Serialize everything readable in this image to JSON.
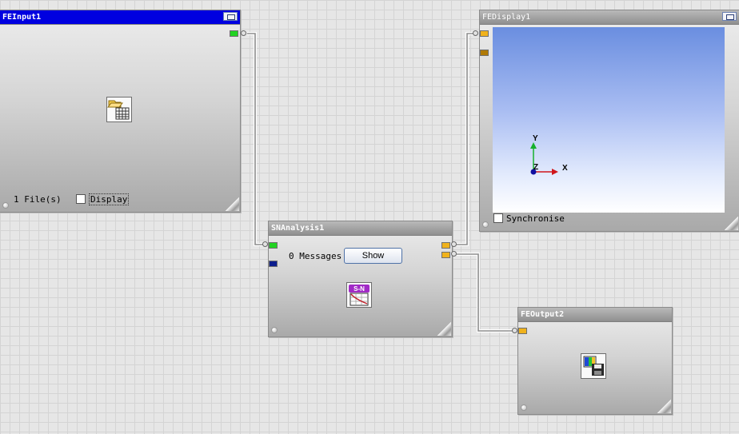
{
  "nodes": {
    "fe_input": {
      "title": "FEInput1",
      "file_count": "1 File(s)",
      "display_label": "Display",
      "display_checked": false,
      "icon": "open-folder-grid-icon"
    },
    "fe_display": {
      "title": "FEDisplay1",
      "synchronise_label": "Synchronise",
      "synchronise_checked": false,
      "axes": {
        "y": "Y",
        "z": "Z",
        "x": "X"
      }
    },
    "sn_analysis": {
      "title": "SNAnalysis1",
      "messages": "0 Messages",
      "show_label": "Show",
      "icon_text": "S-N",
      "icon": "sn-curve-icon"
    },
    "fe_output": {
      "title": "FEOutput2",
      "icon": "save-results-icon"
    }
  },
  "colors": {
    "active_titlebar": "#0000e0",
    "port_green": "#22d322",
    "port_orange": "#f0b21c",
    "port_brown": "#b07a06",
    "port_navy": "#0c1d8d",
    "axis_y": "#16b12c",
    "axis_x": "#d0161b",
    "axis_z": "#1010a0"
  },
  "connections": [
    {
      "from": "FEInput1",
      "to": "SNAnalysis1"
    },
    {
      "from": "SNAnalysis1",
      "to": "FEDisplay1"
    },
    {
      "from": "SNAnalysis1",
      "to": "FEOutput2"
    }
  ]
}
